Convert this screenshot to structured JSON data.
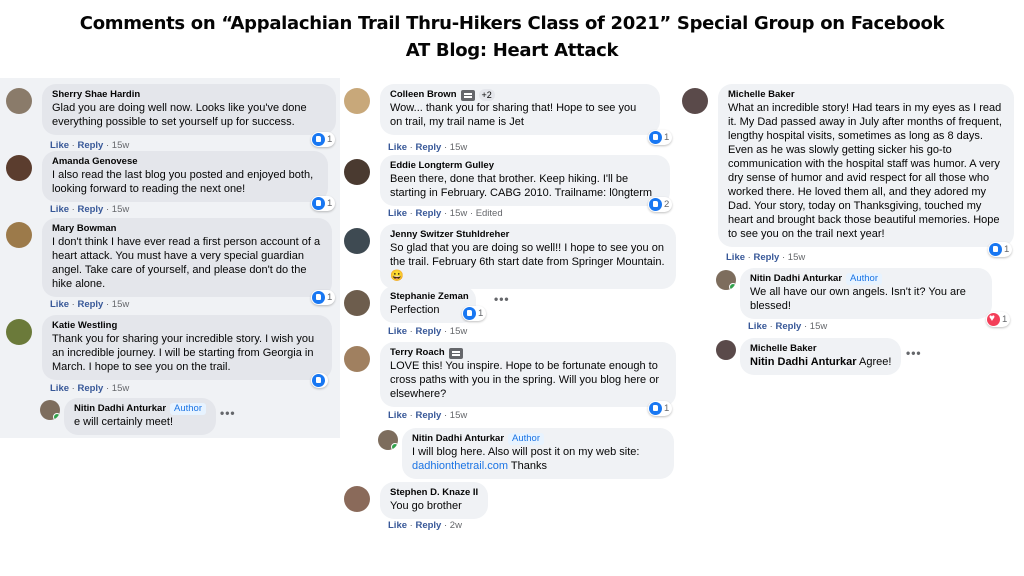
{
  "header": {
    "line1": "Comments on “Appalachian Trail Thru-Hikers Class of 2021” Special Group on Facebook",
    "line2": "AT Blog: Heart Attack"
  },
  "labels": {
    "like": "Like",
    "reply": "Reply",
    "author": "Author",
    "edited": "Edited",
    "more": "•••"
  },
  "colors": {
    "accent": "#1877f2",
    "bubble": "#f0f2f5",
    "meta": "#65676b",
    "heart": "#f33e58"
  },
  "col1": [
    {
      "name": "Sherry Shae Hardin",
      "text": "Glad you are doing well now. Looks like you've done everything possible to set yourself up for success.",
      "time": "15w",
      "reactions": "1"
    },
    {
      "name": "Amanda Genovese",
      "text": "I also read the last blog you posted and enjoyed both, looking forward to reading the next one!",
      "time": "15w",
      "reactions": "1"
    },
    {
      "name": "Mary Bowman",
      "text": "I don't think I have ever read a first person account of a heart attack. You must have a very special guardian angel. Take care of yourself, and please don't do the hike alone.",
      "time": "15w",
      "reactions": "1"
    },
    {
      "name": "Katie Westling",
      "text": "Thank you for sharing your incredible story. I wish you an incredible journey. I will be starting from Georgia in March. I hope to see you on the trail.",
      "time": "15w",
      "reactions": ""
    },
    {
      "name": "Nitin Dadhi Anturkar",
      "text": "e will certainly meet!",
      "time": "",
      "reactions": ""
    }
  ],
  "col2": [
    {
      "name": "Colleen Brown",
      "badge": "+2",
      "text": "Wow... thank you for sharing that! Hope to see you on trail, my trail name is Jet",
      "time": "15w",
      "reactions": "1"
    },
    {
      "name": "Eddie Longterm Gulley",
      "text": "Been there, done that brother. Keep hiking. I'll be starting in February. CABG 2010. Trailname: l0ngterm",
      "time": "15w",
      "reactions": "2"
    },
    {
      "name": "Jenny Switzer Stuhldreher",
      "text": "So glad that you are doing so well!! I hope to see you on the trail. February 6th start date from Springer Mountain.",
      "emoji": "😀",
      "time": "15w",
      "reactions": ""
    },
    {
      "name": "Stephanie Zeman",
      "text": "Perfection",
      "time": "15w",
      "reactions": "1"
    },
    {
      "name": "Terry Roach",
      "text": "LOVE this! You inspire. Hope to be fortunate enough to cross paths with you in the spring. Will you blog here or elsewhere?",
      "time": "15w",
      "reactions": "1"
    },
    {
      "name": "Nitin Dadhi Anturkar",
      "text": "I will blog here. Also will post it on my web site:",
      "link": "dadhionthetrail.com",
      "after_link": "Thanks",
      "time": "",
      "reactions": ""
    },
    {
      "name": "Stephen D. Knaze II",
      "text": "You go brother",
      "time": "2w",
      "reactions": ""
    }
  ],
  "col3": [
    {
      "name": "Michelle Baker",
      "text": "What an incredible story! Had tears in my eyes as I read it. My Dad passed away in July after months of frequent, lengthy hospital visits, sometimes as long as 8 days. Even as he was slowly getting sicker his go-to communication with the hospital staff was humor. A very dry sense of humor and avid respect for all those who worked there. He loved them all, and they adored my Dad. Your story, today on Thanksgiving, touched my heart and brought back those beautiful memories. Hope to see you on the trail next year!",
      "time": "15w",
      "reactions": "1"
    },
    {
      "name": "Nitin Dadhi Anturkar",
      "text": "We all have our own angels. Isn't it? You are blessed!",
      "time": "15w",
      "reactions": "1"
    },
    {
      "name": "Michelle Baker",
      "mention": "Nitin Dadhi Anturkar",
      "text": "Agree!",
      "time": "",
      "reactions": ""
    }
  ]
}
